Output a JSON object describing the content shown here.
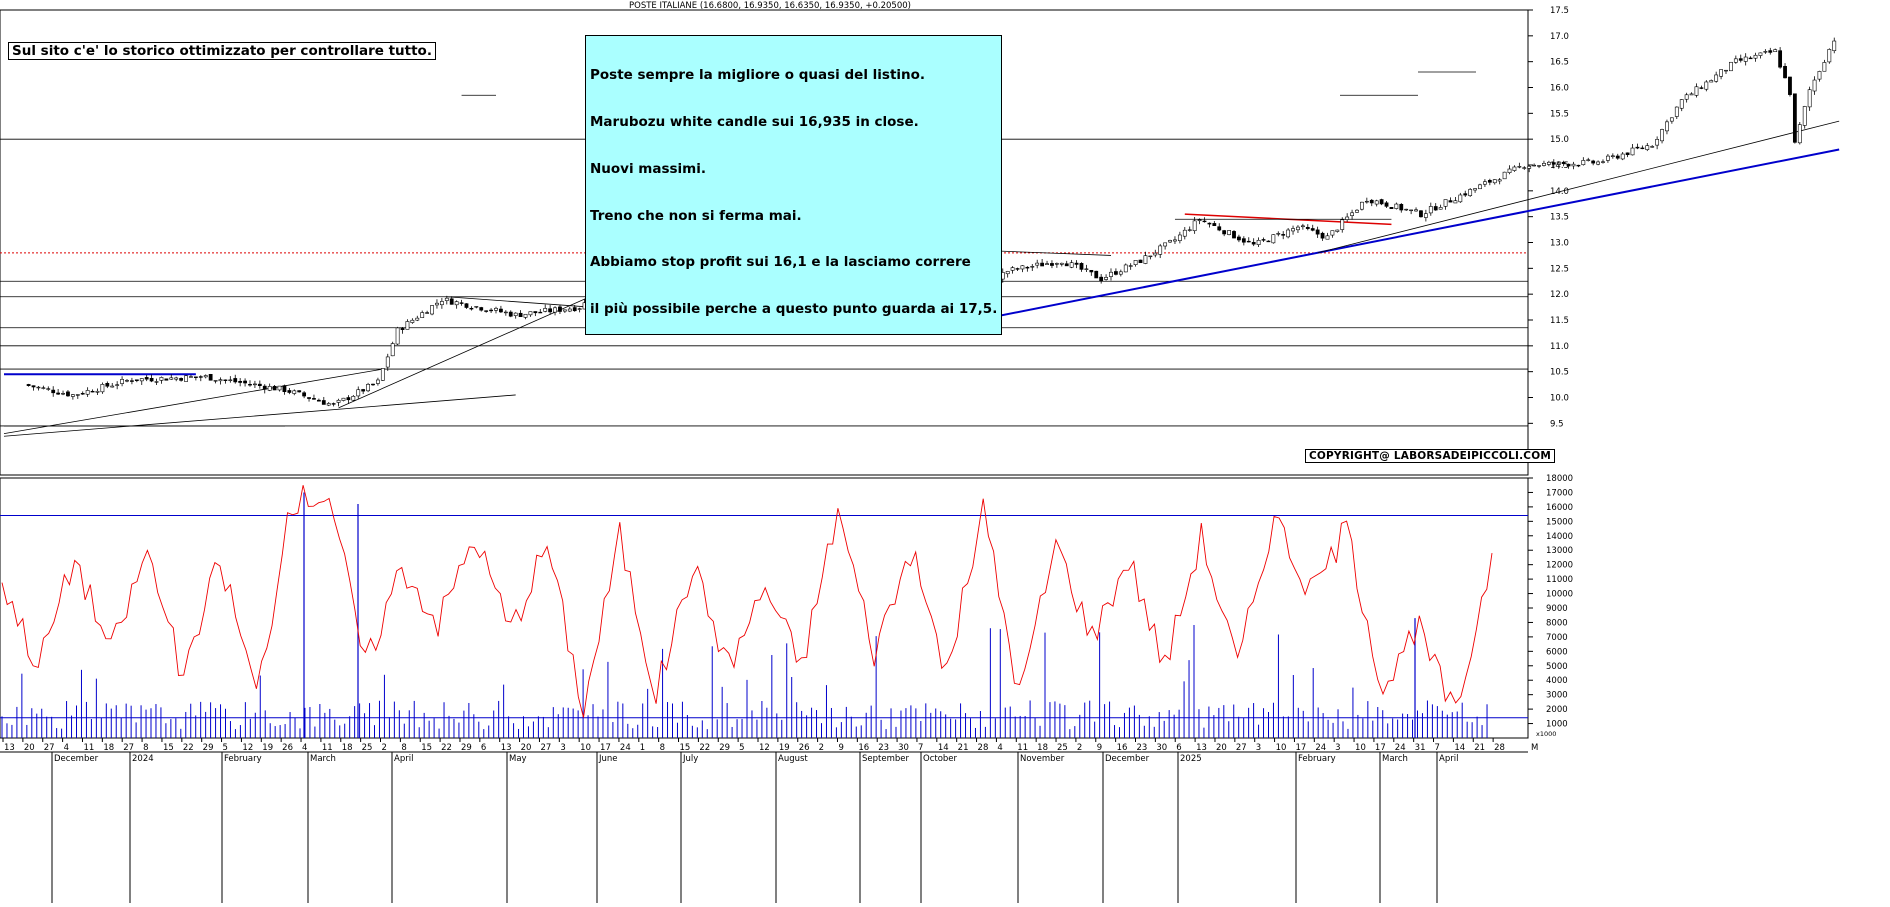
{
  "header": {
    "title": "POSTE ITALIANE (16.6800, 16.9350, 16.6350, 16.9350, +0.20500)"
  },
  "notes": {
    "left_note": "Sul sito c'e' lo storico ottimizzato per controllare tutto.",
    "main_note": [
      "Poste sempre la migliore o quasi del listino.",
      "Marubozu white candle sui 16,935 in close.",
      "Nuovi massimi.",
      "Treno che non si ferma mai.",
      "Abbiamo stop profit sui 16,1 e la lasciamo correre",
      "il più possibile perche a questo punto guarda ai 17,5."
    ],
    "copyright": "COPYRIGHT@ LABORSADEIPICCOLI.COM"
  },
  "colors": {
    "price": "#000000",
    "hline": "#000000",
    "support_trend": "#0000cc",
    "resistance_trend": "#dd0000",
    "resistance_dotted": "#dd0000",
    "volume_bars": "#0000cc",
    "volume_line": "#ee0000",
    "volume_threshold": "#0000cc"
  },
  "chart_data": [
    {
      "type": "candlestick",
      "title": "POSTE ITALIANE (16.6800, 16.9350, 16.6350, 16.9350, +0.20500)",
      "ylim": [
        8.5,
        17.5
      ],
      "y_ticks": [
        "9.5",
        "10.0",
        "10.5",
        "11.0",
        "11.5",
        "12.0",
        "12.5",
        "13.0",
        "13.5",
        "14.0",
        "14.5",
        "15.0",
        "15.5",
        "16.0",
        "16.5",
        "17.0",
        "17.5"
      ],
      "horizontal_levels": [
        9.45,
        10.55,
        11.0,
        11.35,
        11.95,
        12.25,
        15.0
      ],
      "dotted_level": 12.8,
      "key_points": [
        {
          "date": "2023-11-20",
          "close": 10.25
        },
        {
          "date": "2023-12-04",
          "close": 10.05
        },
        {
          "date": "2023-12-20",
          "close": 10.35
        },
        {
          "date": "2024-01-10",
          "close": 10.4
        },
        {
          "date": "2024-02-01",
          "close": 10.15
        },
        {
          "date": "2024-02-15",
          "close": 9.85
        },
        {
          "date": "2024-02-28",
          "close": 10.3
        },
        {
          "date": "2024-03-05",
          "close": 11.3
        },
        {
          "date": "2024-03-18",
          "close": 11.9
        },
        {
          "date": "2024-04-08",
          "close": 11.6
        },
        {
          "date": "2024-04-25",
          "close": 11.75
        },
        {
          "date": "2024-05-10",
          "close": 12.5
        },
        {
          "date": "2024-05-30",
          "close": 12.6
        },
        {
          "date": "2024-06-06",
          "close": 12.95
        },
        {
          "date": "2024-06-14",
          "close": 12.2
        },
        {
          "date": "2024-06-28",
          "close": 12.0
        },
        {
          "date": "2024-07-15",
          "close": 12.2
        },
        {
          "date": "2024-07-25",
          "close": 12.75
        },
        {
          "date": "2024-08-05",
          "close": 11.4
        },
        {
          "date": "2024-08-15",
          "close": 12.05
        },
        {
          "date": "2024-08-26",
          "close": 12.45
        },
        {
          "date": "2024-09-10",
          "close": 12.65
        },
        {
          "date": "2024-09-20",
          "close": 12.3
        },
        {
          "date": "2024-10-02",
          "close": 12.65
        },
        {
          "date": "2024-10-11",
          "close": 13.05
        },
        {
          "date": "2024-10-18",
          "close": 13.45
        },
        {
          "date": "2024-11-04",
          "close": 12.95
        },
        {
          "date": "2024-11-15",
          "close": 13.3
        },
        {
          "date": "2024-11-25",
          "close": 13.1
        },
        {
          "date": "2024-12-05",
          "close": 13.85
        },
        {
          "date": "2024-12-20",
          "close": 13.55
        },
        {
          "date": "2025-01-03",
          "close": 14.0
        },
        {
          "date": "2025-01-20",
          "close": 14.5
        },
        {
          "date": "2025-02-10",
          "close": 14.55
        },
        {
          "date": "2025-02-25",
          "close": 14.9
        },
        {
          "date": "2025-03-05",
          "close": 15.75
        },
        {
          "date": "2025-03-20",
          "close": 16.5
        },
        {
          "date": "2025-04-01",
          "close": 16.7
        },
        {
          "date": "2025-04-04",
          "close": 15.9
        },
        {
          "date": "2025-04-07",
          "close": 14.9
        },
        {
          "date": "2025-04-10",
          "close": 15.95
        },
        {
          "date": "2025-04-17",
          "close": 16.935
        }
      ]
    },
    {
      "type": "bar",
      "title": "",
      "ylim": [
        0,
        18000
      ],
      "y_ticks": [
        "1000",
        "2000",
        "3000",
        "4000",
        "5000",
        "6000",
        "7000",
        "8000",
        "9000",
        "10000",
        "11000",
        "12000",
        "13000",
        "14000",
        "15000",
        "16000",
        "17000",
        "18000"
      ],
      "threshold": 15400,
      "baseline_level": 1400,
      "axis_unit": "x1000",
      "volume_oscillator_samples": [
        11000,
        5000,
        12500,
        6000,
        13000,
        4000,
        12500,
        3000,
        16500,
        17000,
        5000,
        12000,
        8000,
        14000,
        7500,
        13500,
        2000,
        14000,
        3000,
        12000,
        5000,
        10500,
        5000,
        15800,
        6000,
        13000,
        4500,
        15800,
        3000,
        13500,
        7000,
        12500,
        5000,
        14000,
        5000,
        15500,
        10000,
        14500,
        3500,
        7500,
        1500,
        12800
      ]
    }
  ],
  "x_axis": {
    "day_ticks": [
      "13",
      "20",
      "27",
      "4",
      "11",
      "18",
      "27",
      "8",
      "15",
      "22",
      "29",
      "5",
      "12",
      "19",
      "26",
      "4",
      "11",
      "18",
      "25",
      "2",
      "8",
      "15",
      "22",
      "29",
      "6",
      "13",
      "20",
      "27",
      "3",
      "10",
      "17",
      "24",
      "1",
      "8",
      "15",
      "22",
      "29",
      "5",
      "12",
      "19",
      "26",
      "2",
      "9",
      "16",
      "23",
      "30",
      "7",
      "14",
      "21",
      "28",
      "4",
      "11",
      "18",
      "25",
      "2",
      "9",
      "16",
      "23",
      "30",
      "6",
      "13",
      "20",
      "27",
      "3",
      "10",
      "17",
      "24",
      "3",
      "10",
      "17",
      "24",
      "31",
      "7",
      "14",
      "21",
      "28"
    ],
    "month_labels": [
      "December",
      "2024",
      "February",
      "March",
      "April",
      "May",
      "June",
      "July",
      "August",
      "September",
      "October",
      "November",
      "December",
      "2025",
      "February",
      "March",
      "April"
    ],
    "last_tick": "M"
  }
}
